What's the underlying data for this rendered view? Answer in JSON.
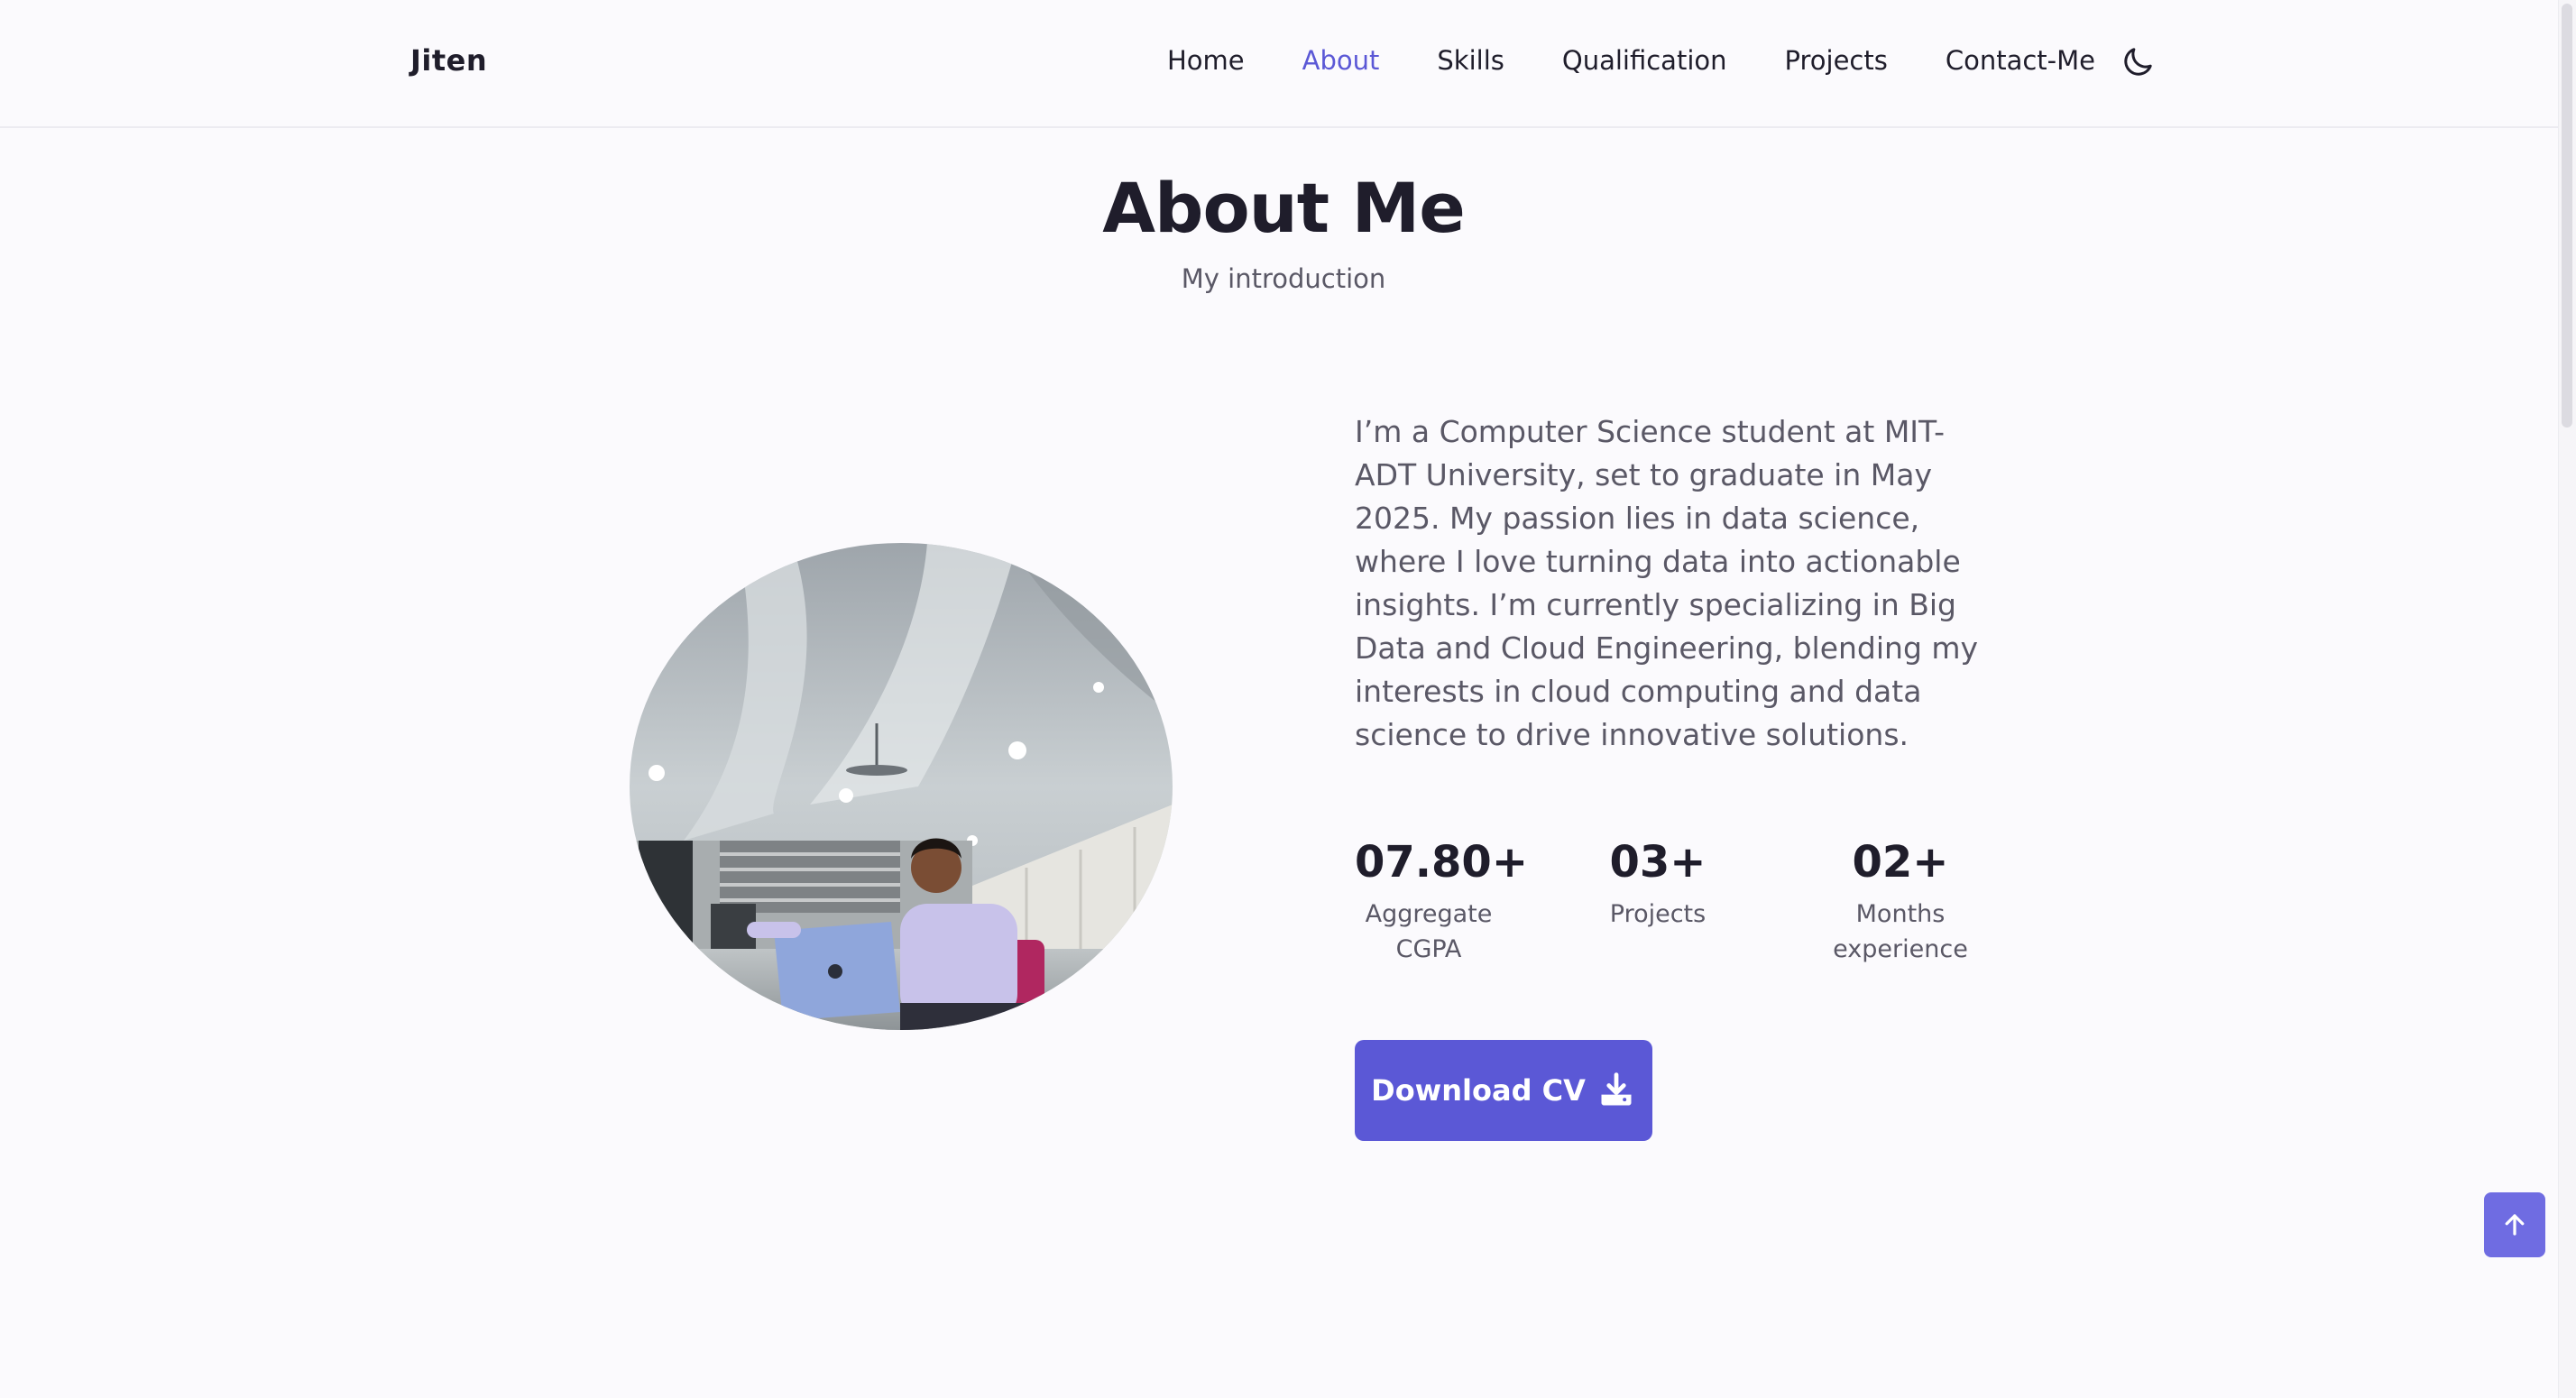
{
  "header": {
    "logo": "Jiten",
    "nav": [
      {
        "label": "Home",
        "active": false
      },
      {
        "label": "About",
        "active": true
      },
      {
        "label": "Skills",
        "active": false
      },
      {
        "label": "Qualification",
        "active": false
      },
      {
        "label": "Projects",
        "active": false
      },
      {
        "label": "Contact-Me",
        "active": false
      }
    ],
    "theme_toggle_icon": "moon-icon"
  },
  "about": {
    "title": "About Me",
    "subtitle": "My introduction",
    "description": "I’m a Computer Science student at MIT-ADT University, set to graduate in May 2025. My passion lies in data science, where I love turning data into actionable insights. I’m currently specializing in Big Data and Cloud Engineering, blending my interests in cloud computing and data science to drive innovative solutions.",
    "stats": [
      {
        "number": "07.80+",
        "label": "Aggregate CGPA"
      },
      {
        "number": "03+",
        "label": "Projects"
      },
      {
        "number": "02+",
        "label": "Months experience"
      }
    ],
    "download_label": "Download CV",
    "download_icon": "download-icon"
  },
  "scroll_up_icon": "arrow-up-icon",
  "colors": {
    "accent": "#5b58d6",
    "background": "#fbfafd",
    "text": "#1f1d2b",
    "muted_text": "#5a5866",
    "scroll_up_bg": "#6f6ce2"
  }
}
